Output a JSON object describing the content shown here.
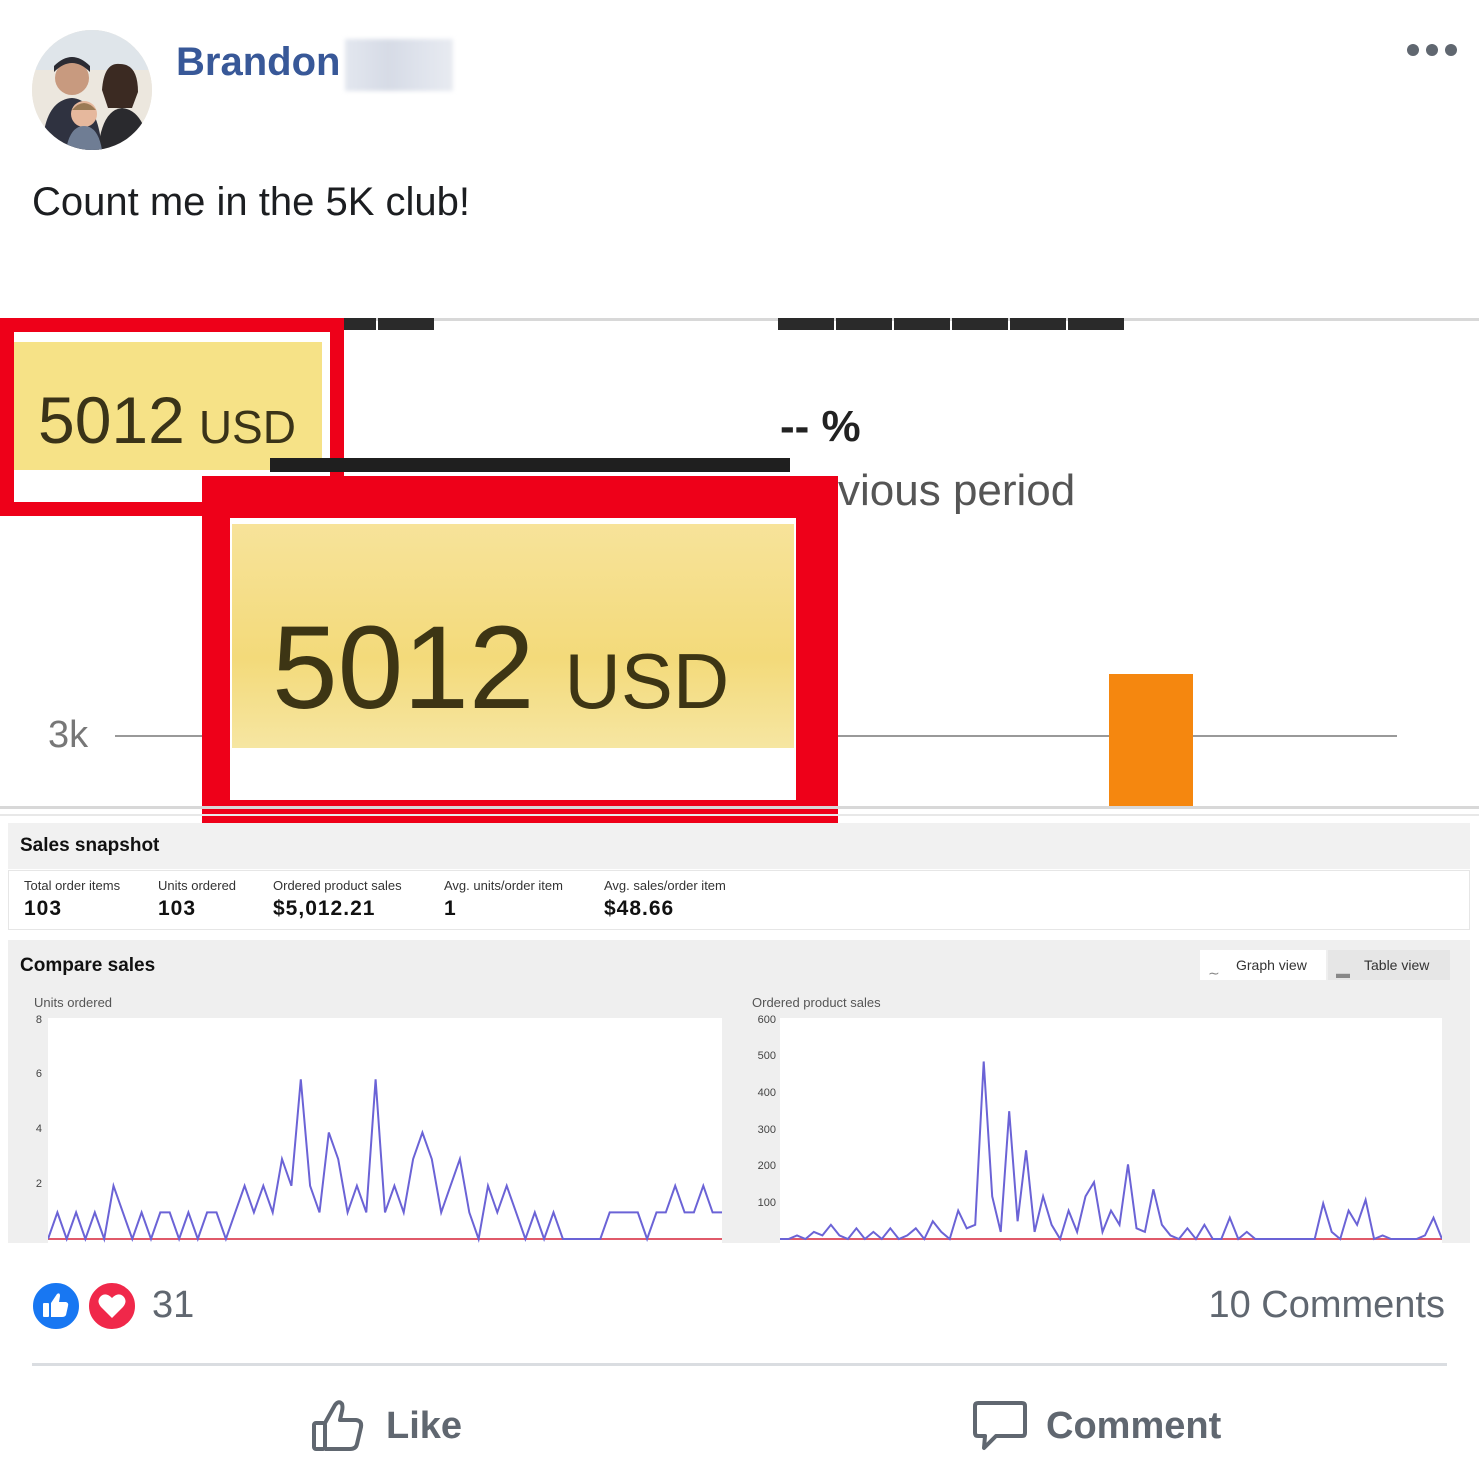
{
  "post": {
    "author": "Brandon",
    "text": "Count me in the 5K club!",
    "more_icon": "ellipsis-icon"
  },
  "image": {
    "highlight_value": "5012",
    "highlight_unit": "USD",
    "percent_text": "-- %",
    "previous_period_text": "vious period",
    "axis_tick": "3k",
    "colors": {
      "frame_red": "#ee0019",
      "highlight_yellow": "#f6e287",
      "bar_orange": "#f5870f"
    },
    "snapshot": {
      "title": "Sales snapshot",
      "metrics": [
        {
          "label": "Total order items",
          "value": "103"
        },
        {
          "label": "Units ordered",
          "value": "103"
        },
        {
          "label": "Ordered product sales",
          "value": "$5,012.21"
        },
        {
          "label": "Avg. units/order item",
          "value": "1"
        },
        {
          "label": "Avg. sales/order item",
          "value": "$48.66"
        }
      ]
    },
    "compare": {
      "title": "Compare sales",
      "graph_view_label": "Graph view",
      "table_view_label": "Table view",
      "left_chart_label": "Units ordered",
      "left_chart_ticks": [
        "8",
        "6",
        "4",
        "2"
      ],
      "right_chart_label": "Ordered product sales",
      "right_chart_ticks": [
        "600",
        "500",
        "400",
        "300",
        "200",
        "100"
      ],
      "left_series": [
        0,
        1,
        0,
        1,
        0,
        1,
        0,
        2,
        1,
        0,
        1,
        0,
        1,
        1,
        0,
        1,
        0,
        1,
        1,
        0,
        1,
        2,
        1,
        2,
        1,
        3,
        2,
        6,
        2,
        1,
        4,
        3,
        1,
        2,
        1,
        6,
        1,
        2,
        1,
        3,
        4,
        3,
        1,
        2,
        3,
        1,
        0,
        2,
        1,
        2,
        1,
        0,
        1,
        0,
        1,
        0,
        0,
        0,
        0,
        0,
        1,
        1,
        1,
        1,
        0,
        1,
        1,
        2,
        1,
        1,
        2,
        1,
        1
      ],
      "right_series": [
        0,
        0,
        10,
        0,
        20,
        10,
        40,
        10,
        0,
        30,
        0,
        20,
        0,
        30,
        0,
        10,
        30,
        0,
        50,
        20,
        0,
        80,
        30,
        40,
        500,
        120,
        20,
        360,
        50,
        250,
        20,
        120,
        40,
        0,
        80,
        20,
        120,
        160,
        20,
        80,
        40,
        210,
        30,
        20,
        140,
        40,
        10,
        0,
        30,
        0,
        40,
        0,
        0,
        60,
        0,
        20,
        0,
        0,
        0,
        0,
        0,
        0,
        0,
        0,
        100,
        20,
        0,
        80,
        40,
        110,
        0,
        10,
        0,
        0,
        0,
        0,
        10,
        60,
        0
      ]
    }
  },
  "footer": {
    "reaction_count": "31",
    "comments_label": "10 Comments",
    "like_label": "Like",
    "comment_label": "Comment"
  }
}
